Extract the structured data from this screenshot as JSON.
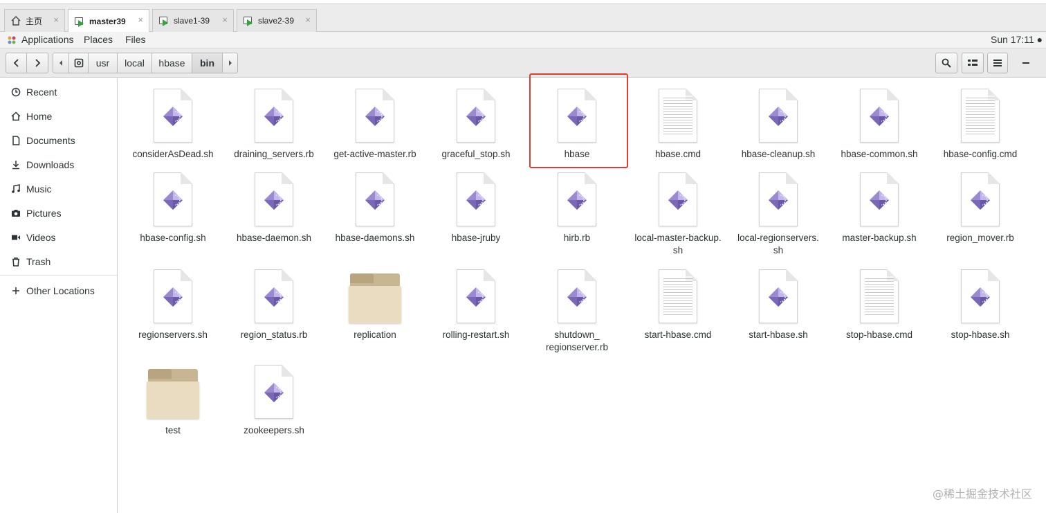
{
  "vm_tabs": [
    {
      "label": "主页",
      "icon": "home-icon"
    },
    {
      "label": "master39",
      "icon": "vm-icon",
      "active": true
    },
    {
      "label": "slave1-39",
      "icon": "vm-icon"
    },
    {
      "label": "slave2-39",
      "icon": "vm-icon"
    }
  ],
  "close_glyph": "×",
  "topbar": {
    "applications": "Applications",
    "places": "Places",
    "files": "Files",
    "clock": "Sun 17:11 ●"
  },
  "breadcrumb": [
    "usr",
    "local",
    "hbase",
    "bin"
  ],
  "breadcrumb_current": "bin",
  "sidebar": [
    {
      "label": "Recent",
      "icon": "clock-icon"
    },
    {
      "label": "Home",
      "icon": "home-icon"
    },
    {
      "label": "Documents",
      "icon": "document-icon"
    },
    {
      "label": "Downloads",
      "icon": "download-icon"
    },
    {
      "label": "Music",
      "icon": "music-icon"
    },
    {
      "label": "Pictures",
      "icon": "camera-icon"
    },
    {
      "label": "Videos",
      "icon": "video-icon"
    },
    {
      "label": "Trash",
      "icon": "trash-icon"
    },
    {
      "label": "Other Locations",
      "icon": "plus-icon"
    }
  ],
  "files": [
    {
      "name": "considerAsDead.sh",
      "type": "script"
    },
    {
      "name": "draining_servers.rb",
      "type": "script"
    },
    {
      "name": "get-active-master.rb",
      "type": "script"
    },
    {
      "name": "graceful_stop.sh",
      "type": "script"
    },
    {
      "name": "hbase",
      "type": "script",
      "highlighted": true
    },
    {
      "name": "hbase.cmd",
      "type": "text"
    },
    {
      "name": "hbase-cleanup.sh",
      "type": "script"
    },
    {
      "name": "hbase-common.sh",
      "type": "script"
    },
    {
      "name": "hbase-config.cmd",
      "type": "text"
    },
    {
      "name": "hbase-config.sh",
      "type": "script"
    },
    {
      "name": "hbase-daemon.sh",
      "type": "script"
    },
    {
      "name": "hbase-daemons.sh",
      "type": "script"
    },
    {
      "name": "hbase-jruby",
      "type": "script"
    },
    {
      "name": "hirb.rb",
      "type": "script"
    },
    {
      "name": "local-master-backup.sh",
      "type": "script",
      "label_lines": [
        "local-master-backup.",
        "sh"
      ]
    },
    {
      "name": "local-regionservers.sh",
      "type": "script",
      "label_lines": [
        "local-regionservers.",
        "sh"
      ]
    },
    {
      "name": "master-backup.sh",
      "type": "script"
    },
    {
      "name": "region_mover.rb",
      "type": "script"
    },
    {
      "name": "regionservers.sh",
      "type": "script"
    },
    {
      "name": "region_status.rb",
      "type": "script"
    },
    {
      "name": "replication",
      "type": "folder"
    },
    {
      "name": "rolling-restart.sh",
      "type": "script"
    },
    {
      "name": "shutdown_regionserver.rb",
      "type": "script",
      "label_lines": [
        "shutdown_",
        "regionserver.rb"
      ]
    },
    {
      "name": "start-hbase.cmd",
      "type": "text"
    },
    {
      "name": "start-hbase.sh",
      "type": "script"
    },
    {
      "name": "stop-hbase.cmd",
      "type": "text"
    },
    {
      "name": "stop-hbase.sh",
      "type": "script"
    },
    {
      "name": "test",
      "type": "folder"
    },
    {
      "name": "zookeepers.sh",
      "type": "script"
    }
  ],
  "watermark": "@稀土掘金技术社区",
  "colors": {
    "highlight": "#e23b2f",
    "script_icon": "#8b78c4"
  }
}
